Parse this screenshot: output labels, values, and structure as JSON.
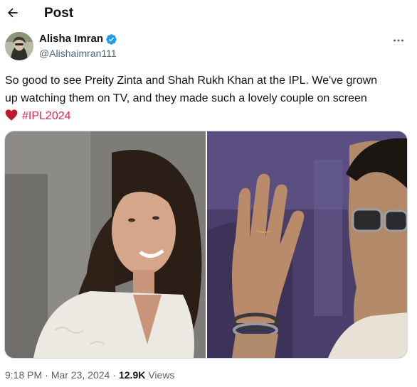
{
  "header": {
    "title": "Post",
    "back_icon": "arrow-left-icon"
  },
  "author": {
    "display_name": "Alisha Imran",
    "handle": "@Alishaimran111",
    "verified": true,
    "verified_color": "#1d9bf0"
  },
  "tweet": {
    "text_line1": "So good to see Preity Zinta and Shah Rukh Khan at the IPL. We've grown",
    "text_line2": "up watching them on TV, and they made such a lovely couple on screen",
    "hashtag": "#IPL2024",
    "hashtag_color": "#e0245e",
    "emoji_icon": "red-heart-icon"
  },
  "media": {
    "photos": [
      {
        "description_icon": "photo-woman-smiling"
      },
      {
        "description_icon": "photo-man-waving-sunglasses"
      }
    ]
  },
  "meta": {
    "time": "9:18 PM",
    "date": "Mar 23, 2024",
    "separator": "·",
    "views_count": "12.9K",
    "views_label": "Views"
  },
  "colors": {
    "secondary_text": "#536471",
    "primary_text": "#0f1419",
    "border": "#cfd9de"
  }
}
